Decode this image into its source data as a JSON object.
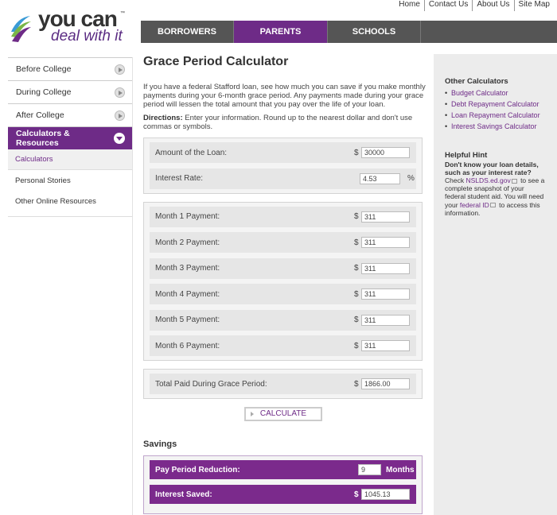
{
  "util_links": [
    "Home",
    "Contact Us",
    "About Us",
    "Site Map"
  ],
  "logo": {
    "line1": "you can",
    "tm": "™",
    "line2": "deal with it"
  },
  "topnav": [
    "BORROWERS",
    "PARENTS",
    "SCHOOLS"
  ],
  "sidebar": {
    "items": [
      {
        "label": "Before College"
      },
      {
        "label": "During College"
      },
      {
        "label": "After College"
      }
    ],
    "active": {
      "label": "Calculators & Resources"
    },
    "subitems": [
      "Calculators",
      "Personal Stories",
      "Other Online Resources"
    ]
  },
  "main": {
    "title": "Grace Period Calculator",
    "intro": "If you have a federal Stafford loan, see how much you can save if you make monthly payments during your 6-month grace period. Any payments made during your grace period will lessen the total amount that you pay over the life of your loan.",
    "directions_label": "Directions:",
    "directions_text": " Enter your information. Round up to the nearest dollar and don't use commas or symbols.",
    "loan": {
      "label": "Amount of the Loan:",
      "currency": "$",
      "value": "30000"
    },
    "rate": {
      "label": "Interest Rate:",
      "value": "4.53",
      "unit": "%"
    },
    "payments": [
      {
        "label": "Month 1 Payment:",
        "currency": "$",
        "value": "311"
      },
      {
        "label": "Month 2 Payment:",
        "currency": "$",
        "value": "311"
      },
      {
        "label": "Month 3 Payment:",
        "currency": "$",
        "value": "311"
      },
      {
        "label": "Month 4 Payment:",
        "currency": "$",
        "value": "311"
      },
      {
        "label": "Month 5 Payment:",
        "currency": "$",
        "value": "311"
      },
      {
        "label": "Month 6 Payment:",
        "currency": "$",
        "value": "311"
      }
    ],
    "total": {
      "label": "Total Paid During Grace Period:",
      "currency": "$",
      "value": "1866.00"
    },
    "calculate_label": "CALCULATE",
    "savings_title": "Savings",
    "reduction": {
      "label": "Pay Period Reduction:",
      "value": "9",
      "unit": "Months"
    },
    "interest_saved": {
      "label": "Interest Saved:",
      "currency": "$",
      "value": "1045.13"
    }
  },
  "right": {
    "other_title": "Other Calculators",
    "calculators": [
      "Budget Calculator",
      "Debt Repayment Calculator",
      "Loan Repayment Calculator",
      "Interest Savings Calculator"
    ],
    "hint_title": "Helpful Hint",
    "hint_question": "Don't know your loan details, such as your interest rate?",
    "hint_p1": "Check ",
    "hint_link1": "NSLDS.ed.gov",
    "hint_p2": " to see a complete snapshot of your federal student aid. You will need your ",
    "hint_link2": "federal ID",
    "hint_p3": " to access this information."
  },
  "colors": {
    "purple": "#6e2b87",
    "nav_gray": "#555555",
    "panel_gray": "#ececec"
  }
}
